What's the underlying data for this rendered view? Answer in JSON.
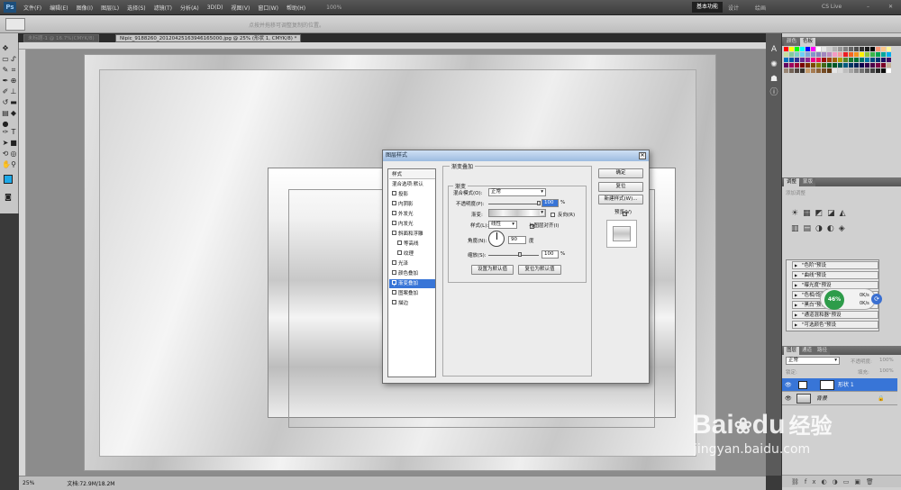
{
  "menubar": {
    "logo": "Ps",
    "items": [
      "文件(F)",
      "编辑(E)",
      "图像(I)",
      "图层(L)",
      "选择(S)",
      "滤镜(T)",
      "分析(A)",
      "3D(D)",
      "视图(V)",
      "窗口(W)",
      "帮助(H)"
    ],
    "zoom": "100%",
    "workspace": "基本功能",
    "design": "设计",
    "painting": "绘画",
    "cslive": "CS Live"
  },
  "options": {
    "hint": "点按并拖移可调整复制的位置。"
  },
  "tabs": [
    {
      "label": "未标题-1 @ 16.7%(CMYK/8)"
    },
    {
      "label": "Nipic_9188260_20120425163946165000.jpg @ 25% (形状 1, CMYK/8) *"
    }
  ],
  "status": {
    "zoom": "25%",
    "doc": "文档:72.9M/18.2M"
  },
  "dialog": {
    "title": "图层样式",
    "list": [
      "样式",
      "混合选项:默认",
      "投影",
      "内阴影",
      "外发光",
      "内发光",
      "斜面和浮雕",
      "等高线",
      "纹理",
      "光泽",
      "颜色叠加",
      "渐变叠加",
      "图案叠加",
      "描边"
    ],
    "panel_title": "渐变叠加",
    "sub_title": "渐变",
    "blend_label": "混合模式(O):",
    "blend_value": "正常",
    "opacity_label": "不透明度(P):",
    "opacity_value": "100",
    "opacity_unit": "%",
    "gradient_label": "渐变:",
    "reverse_label": "反向(R)",
    "style_label": "样式(L):",
    "style_value": "线性",
    "align_label": "与图层对齐(I)",
    "angle_label": "角度(N):",
    "angle_value": "90",
    "angle_unit": "度",
    "scale_label": "缩放(S):",
    "scale_value": "100",
    "scale_unit": "%",
    "set_default": "设置为默认值",
    "reset_default": "复位为默认值",
    "ok": "确定",
    "reset": "复位",
    "new_style": "新建样式(W)...",
    "preview": "预览(V)"
  },
  "right": {
    "swatch_tabs": [
      "颜色",
      "色板"
    ],
    "adjust_tabs": [
      "调整",
      "蒙版"
    ],
    "adjust_hint": "添加调整",
    "presets": [
      "\"色阶\"预设",
      "\"曲线\"预设",
      "\"曝光度\"预设",
      "\"色相/饱和度\"预设",
      "\"黑白\"预设",
      "\"通道混和器\"预设",
      "\"可选颜色\"预设"
    ],
    "badge": "46%",
    "speed_up": "0K/s",
    "speed_down": "0K/s",
    "layer_tabs": [
      "图层",
      "通道",
      "路径"
    ],
    "blend": "正常",
    "opacity_label": "不透明度:",
    "opacity": "100%",
    "lock_label": "锁定:",
    "fill_label": "填充:",
    "fill": "100%",
    "layers": [
      "形状 1",
      "背景"
    ]
  },
  "watermark": {
    "brand": "Bai",
    "brand2": "du",
    "cn": "经验",
    "url": "jingyan.baidu.com"
  }
}
